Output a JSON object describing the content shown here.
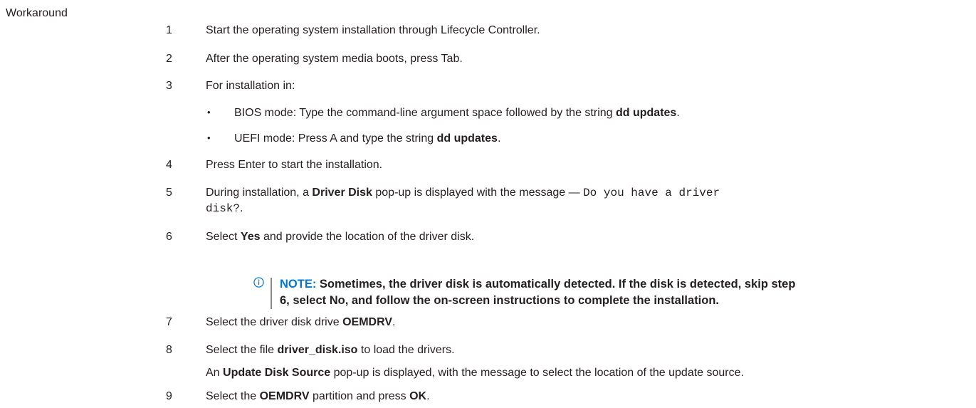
{
  "section_label": "Workaround",
  "steps": [
    {
      "num": "1",
      "text": "Start the operating system installation through Lifecycle Controller."
    },
    {
      "num": "2",
      "text": "After the operating system media boots, press Tab."
    },
    {
      "num": "3",
      "text": "For installation in:"
    },
    {
      "num": "4",
      "text": "Press Enter to start the installation."
    },
    {
      "num": "5",
      "pre": "During installation, a ",
      "bold": "Driver Disk",
      "mid": " pop-up is displayed with the message — ",
      "code1": "Do you have a driver",
      "code2": "disk?",
      "end": "."
    },
    {
      "num": "6",
      "pre": "Select ",
      "bold": "Yes",
      "post": " and provide the location of the driver disk."
    },
    {
      "num": "7",
      "pre": "Select the driver disk drive ",
      "bold": "OEMDRV",
      "post": "."
    },
    {
      "num": "8",
      "pre": "Select the file ",
      "bold": "driver_disk.iso",
      "post": " to load the drivers."
    },
    {
      "num": "9",
      "pre": "Select the ",
      "bold": "OEMDRV",
      "mid": " partition and press ",
      "bold2": "OK",
      "post": "."
    }
  ],
  "bullets": [
    {
      "marker": "•",
      "pre": "BIOS mode: Type the command-line argument space followed by the string ",
      "bold": "dd updates",
      "post": "."
    },
    {
      "marker": "•",
      "pre": "UEFI mode: Press A and type the string ",
      "bold": "dd updates",
      "post": "."
    }
  ],
  "note": {
    "icon": "info-icon",
    "label": "NOTE:",
    "line1": " Sometimes, the driver disk is automatically detected. If the disk is detected, skip step",
    "line2": "6, select No, and follow the on-screen instructions to complete the installation."
  },
  "step8_followup": {
    "pre": "An ",
    "bold": "Update Disk Source",
    "post": " pop-up is displayed, with the message to select the location of the update source."
  },
  "colors": {
    "text": "#231f20",
    "note_label": "#0076ce"
  }
}
